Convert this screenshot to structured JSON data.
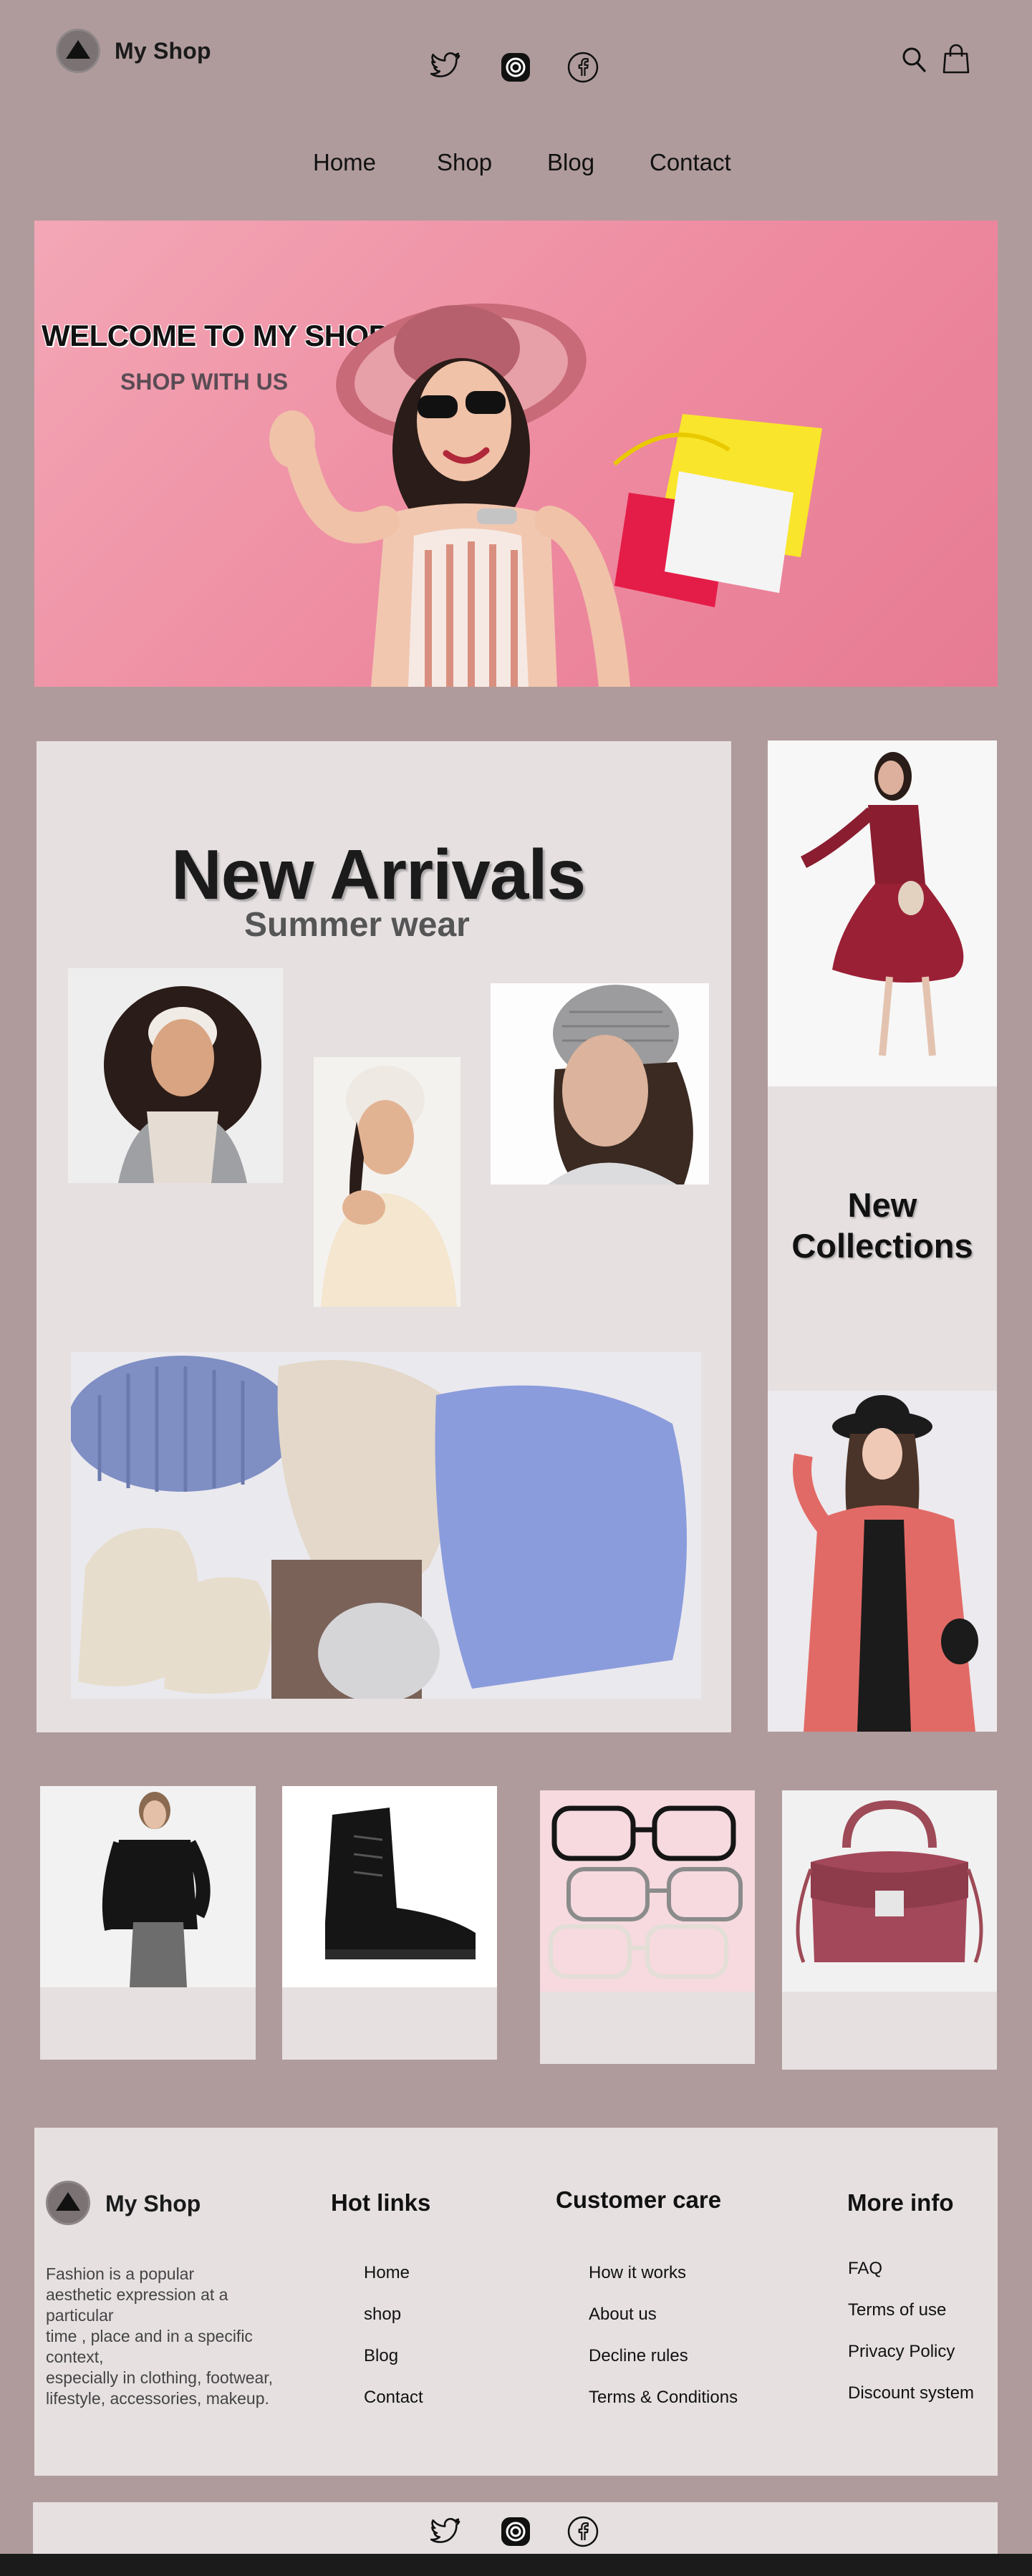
{
  "header": {
    "brand": "My Shop",
    "social": [
      "twitter-icon",
      "instagram-icon",
      "facebook-icon"
    ],
    "actions": [
      "search-icon",
      "shopping-bag-icon"
    ]
  },
  "nav": {
    "items": [
      {
        "label": "Home"
      },
      {
        "label": "Shop"
      },
      {
        "label": "Blog"
      },
      {
        "label": "Contact"
      }
    ]
  },
  "hero": {
    "title": "WELCOME TO MY SHOP",
    "subtitle": "SHOP WITH US",
    "accent": "#f0a0b3"
  },
  "new_arrivals": {
    "title": "New Arrivals",
    "subtitle": "Summer wear"
  },
  "new_collections": {
    "title_line1": "New",
    "title_line2": "Collections"
  },
  "products": [
    {
      "icon": "cardigan-model-photo"
    },
    {
      "icon": "black-boot-photo"
    },
    {
      "icon": "eyeglasses-photo"
    },
    {
      "icon": "handbag-photo"
    }
  ],
  "footer": {
    "brand": "My Shop",
    "description": "Fashion is a popular\naesthetic expression at a\nparticular\ntime , place and in a specific\ncontext,\nespecially in clothing, footwear,\nlifestyle, accessories, makeup.",
    "hot_links": {
      "heading": "Hot links",
      "items": [
        "Home",
        "shop",
        "Blog",
        "Contact"
      ]
    },
    "customer_care": {
      "heading": "Customer care",
      "items": [
        "How it works",
        "About us",
        "Decline rules",
        "Terms & Conditions"
      ]
    },
    "more_info": {
      "heading": "More info",
      "items": [
        "FAQ",
        "Terms of use",
        "Privacy Policy",
        "Discount system"
      ]
    }
  },
  "colors": {
    "background": "#b09b9c",
    "panel": "#e6e0e1",
    "hero_pink": "#f0a0b3"
  }
}
